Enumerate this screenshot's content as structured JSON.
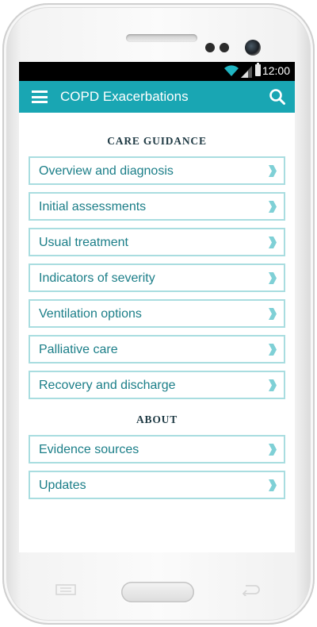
{
  "status_bar": {
    "time": "12:00"
  },
  "app_bar": {
    "title": "COPD Exacerbations"
  },
  "sections": {
    "care_guidance": {
      "title": "CARE GUIDANCE",
      "items": [
        "Overview and diagnosis",
        "Initial assessments",
        "Usual treatment",
        "Indicators of severity",
        "Ventilation options",
        "Palliative care",
        "Recovery and discharge"
      ]
    },
    "about": {
      "title": "ABOUT",
      "items": [
        "Evidence sources",
        "Updates"
      ]
    }
  },
  "colors": {
    "app_bar": "#19a6b3",
    "item_border": "#a9dde0",
    "item_text": "#1b7e88",
    "chevron": "#7fd0d6"
  },
  "icons": [
    "menu-icon",
    "search-icon",
    "chevron-right-icon",
    "wifi-icon",
    "signal-icon",
    "battery-icon"
  ]
}
